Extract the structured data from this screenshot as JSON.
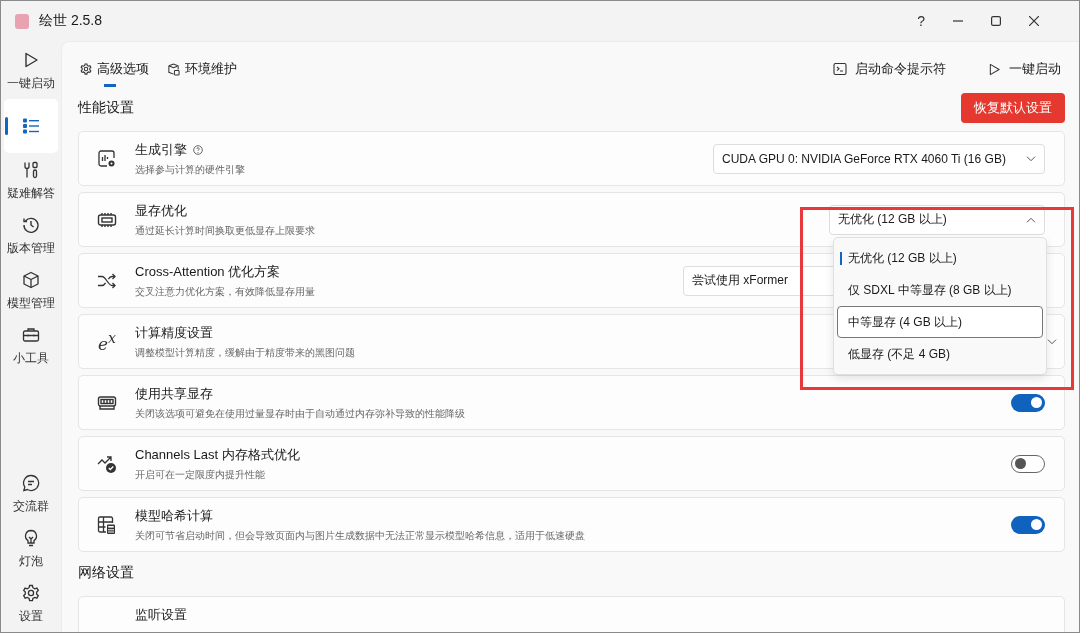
{
  "window": {
    "title": "绘世 2.5.8",
    "help_label": "?"
  },
  "sidebar": {
    "items": [
      {
        "label": "一键启动",
        "selected": false
      },
      {
        "selected": true
      },
      {
        "label": "疑难解答",
        "selected": false
      },
      {
        "label": "版本管理",
        "selected": false
      },
      {
        "label": "模型管理",
        "selected": false
      },
      {
        "label": "小工具",
        "selected": false
      }
    ],
    "bottom_items": [
      {
        "label": "交流群",
        "selected": false
      },
      {
        "label": "灯泡",
        "selected": false
      },
      {
        "label": "设置",
        "selected": false
      }
    ]
  },
  "tabs": [
    {
      "label": "高级选项",
      "selected": true
    },
    {
      "label": "环境维护",
      "selected": false
    }
  ],
  "actions": [
    {
      "label": "启动命令提示符"
    },
    {
      "label": "一键启动"
    }
  ],
  "sections": [
    {
      "title": "性能设置",
      "reset_button": "恢复默认设置",
      "rows": [
        {
          "title": "生成引擎",
          "help_icon": true,
          "description": "选择参与计算的硬件引擎",
          "kind": "select",
          "value": "CUDA GPU 0: NVIDIA GeForce RTX 4060 Ti (16 GB)",
          "open": false
        },
        {
          "title": "显存优化",
          "help_icon": false,
          "description": "通过延长计算时间换取更低显存上限要求",
          "kind": "select",
          "value": "无优化 (12 GB 以上)",
          "open": true,
          "options": [
            {
              "label": "无优化 (12 GB 以上)",
              "selected": true,
              "hovered": false
            },
            {
              "label": "仅 SDXL 中等显存 (8 GB 以上)",
              "selected": false,
              "hovered": false
            },
            {
              "label": "中等显存 (4 GB 以上)",
              "selected": false,
              "hovered": true
            },
            {
              "label": "低显存 (不足 4 GB)",
              "selected": false,
              "hovered": false
            }
          ]
        },
        {
          "title": "Cross-Attention 优化方案",
          "help_icon": false,
          "description": "交叉注意力优化方案，有效降低显存用量",
          "kind": "select",
          "value": "尝试使用 xFormer",
          "open": false
        },
        {
          "title": "计算精度设置",
          "icon_text": "e$^{x}$",
          "help_icon": false,
          "description": "调整模型计算精度，缓解由于精度带来的黑图问题",
          "kind": "select",
          "open": false
        },
        {
          "title": "使用共享显存",
          "help_icon": false,
          "description": "关闭该选项可避免在使用过量显存时由于自动通过内存弥补导致的性能降级",
          "kind": "toggle",
          "on": true
        },
        {
          "title": "Channels Last 内存格式优化",
          "help_icon": false,
          "description": "开启可在一定限度内提升性能",
          "kind": "toggle",
          "on": false
        },
        {
          "title": "模型哈希计算",
          "help_icon": false,
          "description": "关闭可节省启动时间，但会导致页面内与图片生成数据中无法正常显示模型哈希信息，适用于低速硬盘",
          "kind": "toggle",
          "on": true
        }
      ]
    },
    {
      "title": "网络设置",
      "rows": [
        {
          "title": "监听设置",
          "help_icon": false,
          "kind": "none"
        }
      ]
    }
  ]
}
